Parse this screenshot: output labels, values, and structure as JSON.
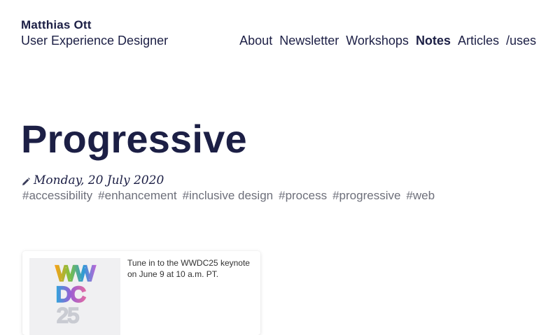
{
  "header": {
    "name": "Matthias Ott",
    "role": "User Experience Designer"
  },
  "nav": {
    "items": [
      {
        "label": "About",
        "active": false
      },
      {
        "label": "Newsletter",
        "active": false
      },
      {
        "label": "Workshops",
        "active": false
      },
      {
        "label": "Notes",
        "active": true
      },
      {
        "label": "Articles",
        "active": false
      },
      {
        "label": "/uses",
        "active": false
      }
    ]
  },
  "article": {
    "title": "Progressive",
    "date": "Monday, 20 July 2020",
    "date_icon": "pencil-icon",
    "tags": [
      "#accessibility",
      "#enhancement",
      "#inclusive design",
      "#process",
      "#progressive",
      "#web"
    ]
  },
  "embed": {
    "text": "Tune in to the WWDC25 keynote on June 9 at 10 a.m. PT.",
    "image": {
      "line1": "WW",
      "line2": "DC",
      "line3": "25"
    }
  },
  "colors": {
    "text": "#1c1f45",
    "tag": "#6d6f7a"
  }
}
